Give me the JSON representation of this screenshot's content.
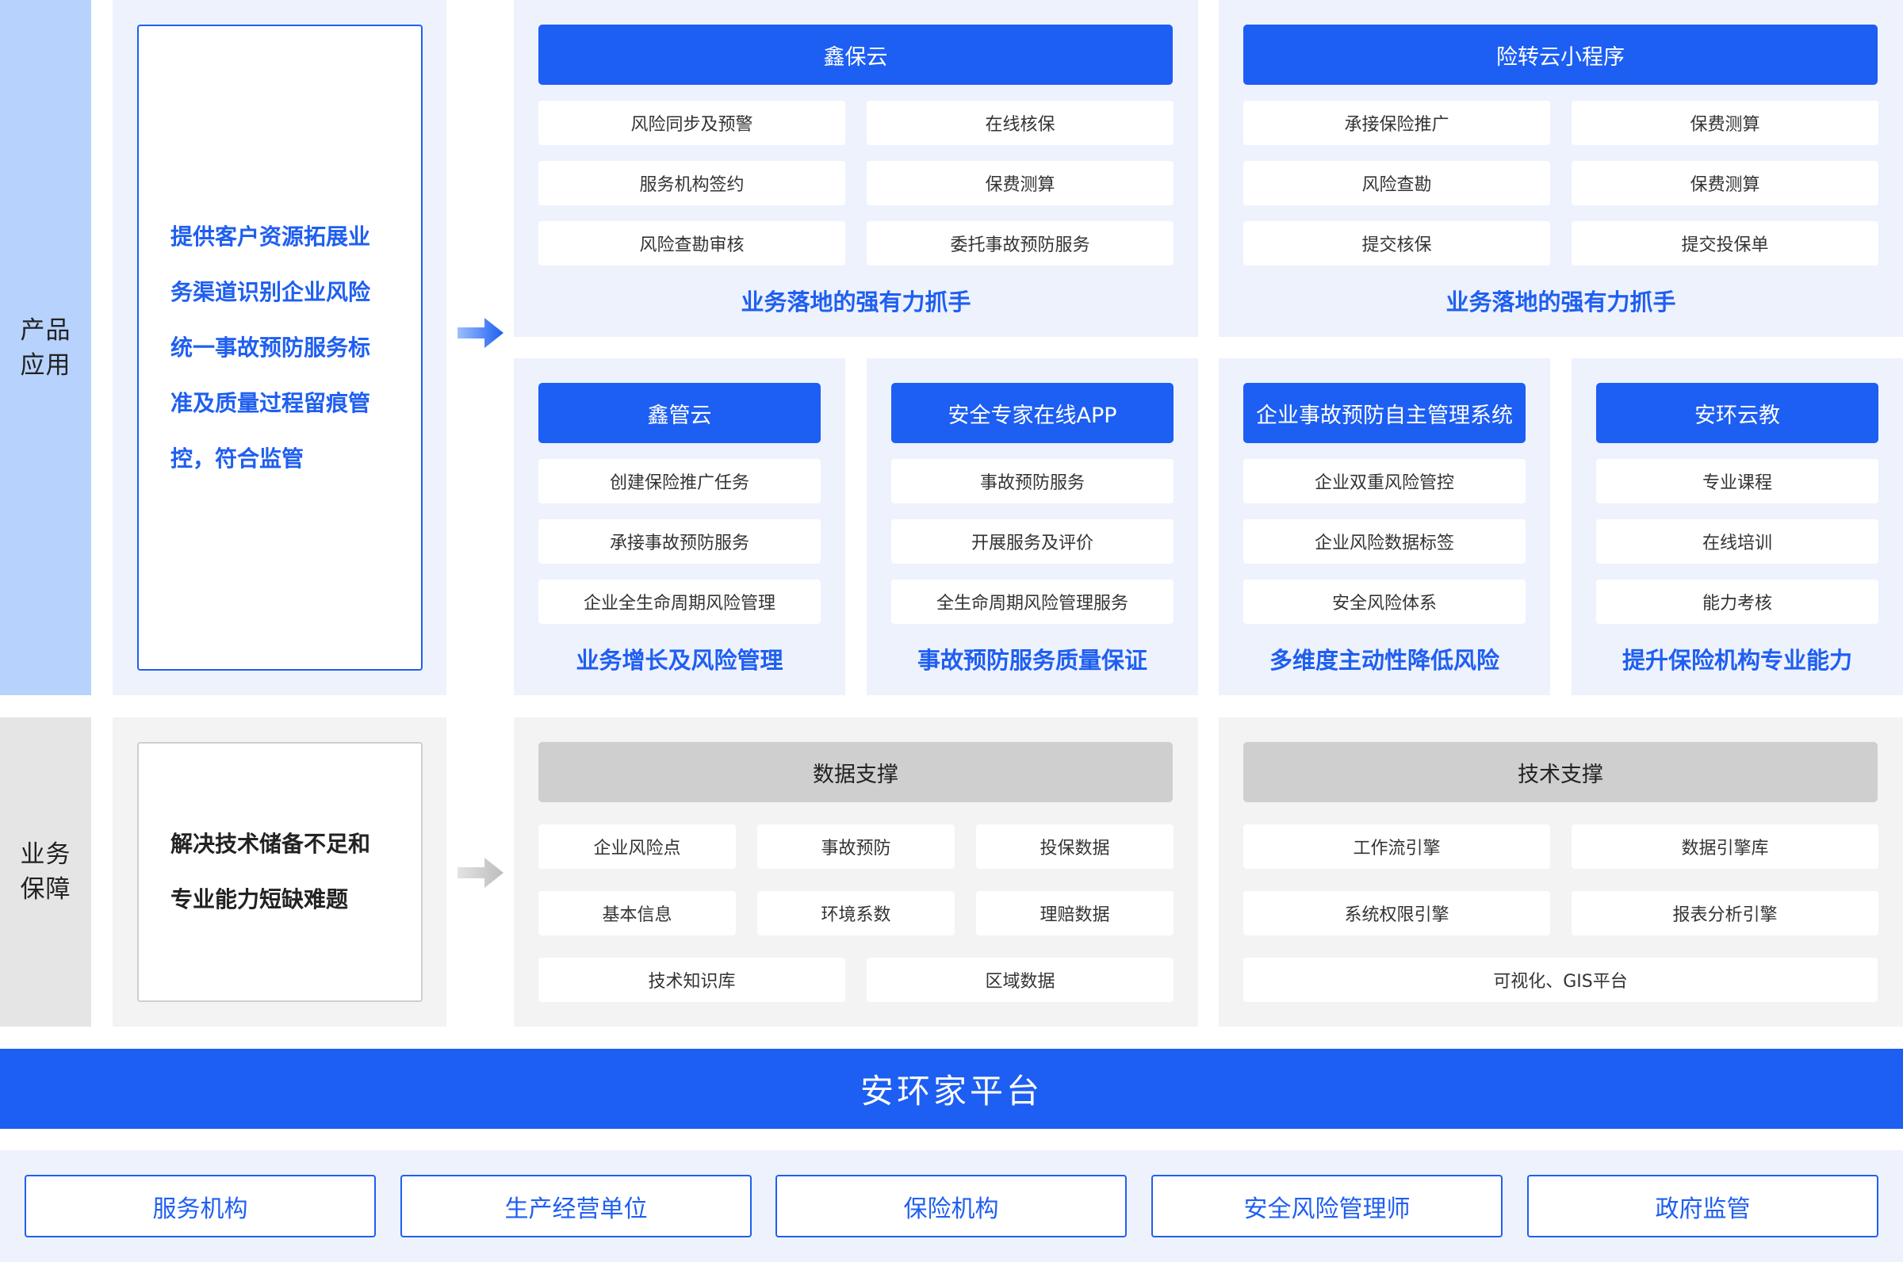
{
  "colors": {
    "brand_blue": "#1d5ef3",
    "side_blue": "#b7d3fd",
    "panel_blue": "#eef2fd",
    "side_gray": "#e5e5e5",
    "panel_gray": "#f3f3f3",
    "header_gray": "#cfcfcf"
  },
  "product_section": {
    "label_line1": "产品",
    "label_line2": "应用",
    "description_lines": [
      "提供客户资源拓展业",
      "务渠道识别企业风险",
      "统一事故预防服务标",
      "准及质量过程留痕管",
      "控，符合监管"
    ],
    "arrow_icon": "arrow-right-icon",
    "modules": [
      {
        "title": "鑫保云",
        "items": [
          "风险同步及预警",
          "在线核保",
          "服务机构签约",
          "保费测算",
          "风险查勘审核",
          "委托事故预防服务"
        ],
        "tagline": "业务落地的强有力抓手"
      },
      {
        "title": "险转云小程序",
        "items": [
          "承接保险推广",
          "保费测算",
          "风险查勘",
          "保费测算",
          "提交核保",
          "提交投保单"
        ],
        "tagline": "业务落地的强有力抓手"
      },
      {
        "title": "鑫管云",
        "items": [
          "创建保险推广任务",
          "承接事故预防服务",
          "企业全生命周期风险管理"
        ],
        "tagline": "业务增长及风险管理"
      },
      {
        "title": "安全专家在线APP",
        "items": [
          "事故预防服务",
          "开展服务及评价",
          "全生命周期风险管理服务"
        ],
        "tagline": "事故预防服务质量保证"
      },
      {
        "title": "企业事故预防自主管理系统",
        "items": [
          "企业双重风险管控",
          "企业风险数据标签",
          "安全风险体系"
        ],
        "tagline": "多维度主动性降低风险"
      },
      {
        "title": "安环云教",
        "items": [
          "专业课程",
          "在线培训",
          "能力考核"
        ],
        "tagline": "提升保险机构专业能力"
      }
    ]
  },
  "support_section": {
    "label_line1": "业务",
    "label_line2": "保障",
    "description_lines": [
      "解决技术储备不足和",
      "专业能力短缺难题"
    ],
    "arrow_icon": "arrow-right-icon",
    "data_support": {
      "title": "数据支撑",
      "items": [
        "企业风险点",
        "事故预防",
        "投保数据",
        "基本信息",
        "环境系数",
        "理赔数据",
        "技术知识库",
        "区域数据"
      ]
    },
    "tech_support": {
      "title": "技术支撑",
      "items": [
        "工作流引擎",
        "数据引擎库",
        "系统权限引擎",
        "报表分析引擎",
        "可视化、GIS平台"
      ]
    }
  },
  "platform": {
    "title": "安环家平台"
  },
  "stakeholders": [
    "服务机构",
    "生产经营单位",
    "保险机构",
    "安全风险管理师",
    "政府监管"
  ]
}
